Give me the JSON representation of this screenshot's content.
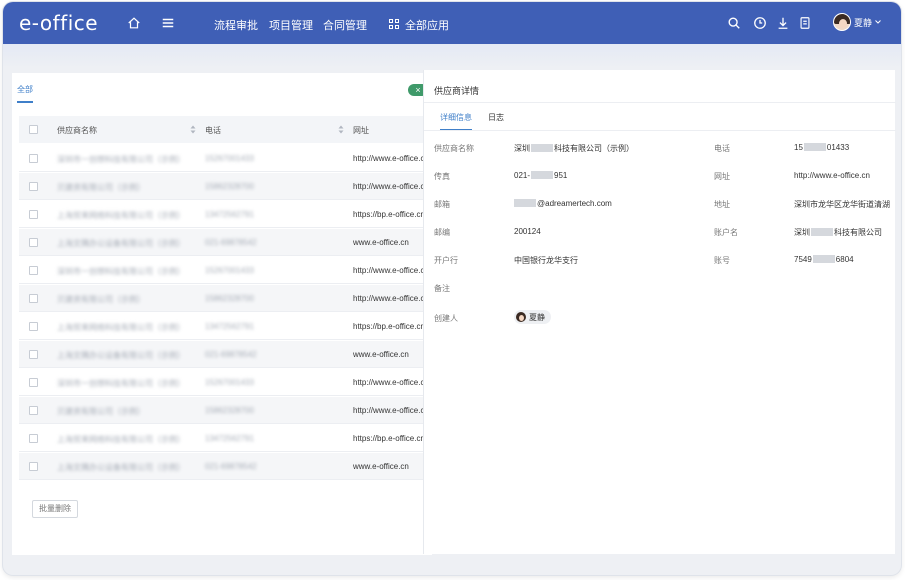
{
  "app": {
    "logo": "e-office"
  },
  "header": {
    "nav": [
      {
        "label": "流程审批"
      },
      {
        "label": "项目管理"
      },
      {
        "label": "合同管理"
      }
    ],
    "all_apps": "全部应用",
    "user_name": "夏静",
    "icons": [
      "home-icon",
      "menu-icon",
      "apps-grid-icon",
      "search-icon",
      "clock-icon",
      "download-icon",
      "notebook-icon",
      "chevron-down-icon"
    ]
  },
  "list": {
    "filter_tab": "全部",
    "close_symbol": "×",
    "columns": {
      "name": "供应商名称",
      "phone": "电话",
      "url": "网址"
    },
    "rows": [
      {
        "name": "深圳市一创想科技有限公司（示例）",
        "phone": "15267001433",
        "url": "http://www.e-office.cn"
      },
      {
        "name": "贝建资有限公司（示例）",
        "phone": "15862328700",
        "url": "http://www.e-office.cn"
      },
      {
        "name": "上海贸来网络科技有限公司（示例）",
        "phone": "13472562791",
        "url": "https://bp.e-office.cn"
      },
      {
        "name": "上海文隅办公设备有限公司（示例）",
        "phone": "021-69878542",
        "url": "www.e-office.cn"
      },
      {
        "name": "深圳市一创想科技有限公司（示例）",
        "phone": "15267001433",
        "url": "http://www.e-office.cn"
      },
      {
        "name": "贝建资有限公司（示例）",
        "phone": "15862328700",
        "url": "http://www.e-office.cn"
      },
      {
        "name": "上海贸来网络科技有限公司（示例）",
        "phone": "13472562791",
        "url": "https://bp.e-office.cn"
      },
      {
        "name": "上海文隅办公设备有限公司（示例）",
        "phone": "021-69878542",
        "url": "www.e-office.cn"
      },
      {
        "name": "深圳市一创想科技有限公司（示例）",
        "phone": "15267001433",
        "url": "http://www.e-office.cn"
      },
      {
        "name": "贝建资有限公司（示例）",
        "phone": "15862328700",
        "url": "http://www.e-office.cn"
      },
      {
        "name": "上海贸来网络科技有限公司（示例）",
        "phone": "13472562791",
        "url": "https://bp.e-office.cn"
      },
      {
        "name": "上海文隅办公设备有限公司（示例）",
        "phone": "021-69878542",
        "url": "www.e-office.cn"
      }
    ],
    "batch_delete": "批量删除"
  },
  "detail": {
    "title": "供应商详情",
    "tabs": [
      "详细信息",
      "日志"
    ],
    "fields": {
      "name_label": "供应商名称",
      "name_pre": "深圳",
      "name_post": "科技有限公司（示例）",
      "phone_label": "电话",
      "phone_pre": "15",
      "phone_post": "01433",
      "fax_label": "传真",
      "fax_pre": "021-",
      "fax_post": "951",
      "url_label": "网址",
      "url_value": "http://www.e-office.cn",
      "email_label": "邮箱",
      "email_post": "@adreamertech.com",
      "address_label": "地址",
      "address_value": "深圳市龙华区龙华街道清湖",
      "zip_label": "邮编",
      "zip_value": "200124",
      "account_name_label": "账户名",
      "account_name_pre": "深圳",
      "account_name_post": "科技有限公司",
      "bank_label": "开户行",
      "bank_value": "中国银行龙华支行",
      "account_no_label": "账号",
      "account_no_pre": "7549",
      "account_no_post": "6804",
      "remark_label": "备注",
      "creator_label": "创建人",
      "creator_value": "夏静"
    }
  },
  "colors": {
    "header_bg": "#3f5fb6",
    "accent": "#3f7fc9",
    "close_pill": "#3f9a6a"
  }
}
